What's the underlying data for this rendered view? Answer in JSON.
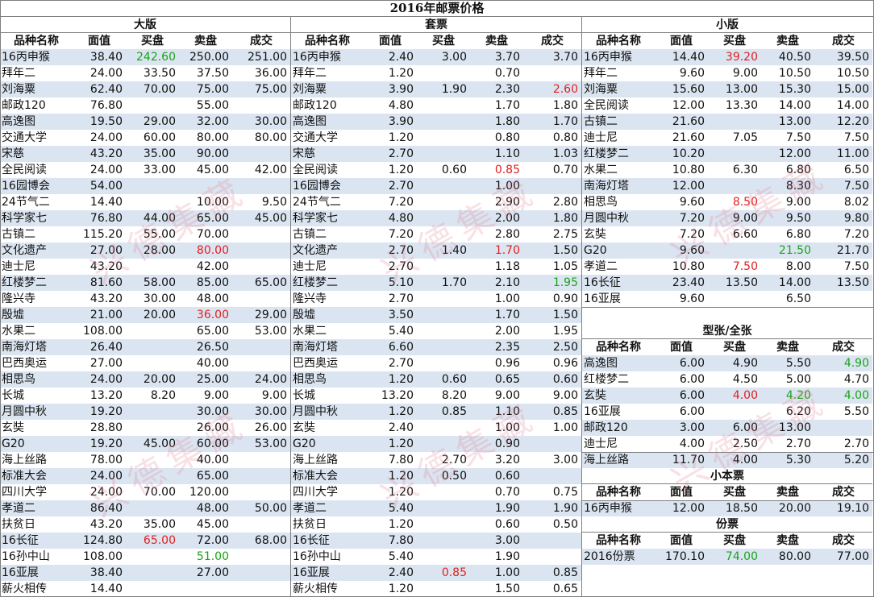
{
  "title": "2016年邮票价格",
  "headers": [
    "品种名称",
    "面值",
    "买盘",
    "卖盘",
    "成交"
  ],
  "colors": {
    "band": "#dbe5f1",
    "red": "#e02020",
    "green": "#1aa31a",
    "grid": "#7f7f7f"
  },
  "watermark": "兴德集藏",
  "panels": [
    {
      "key": "daban",
      "title": "大版",
      "rows": [
        [
          "16丙申猴",
          "38.40",
          "242.60",
          "250.00",
          "251.00"
        ],
        [
          "拜年二",
          "24.00",
          "33.50",
          "37.50",
          "36.00"
        ],
        [
          "刘海粟",
          "62.40",
          "70.00",
          "75.00",
          "75.00"
        ],
        [
          "邮政120",
          "76.80",
          "",
          "55.00",
          ""
        ],
        [
          "高逸图",
          "19.50",
          "29.00",
          "32.00",
          "30.00"
        ],
        [
          "交通大学",
          "24.00",
          "60.00",
          "80.00",
          "80.00"
        ],
        [
          "宋慈",
          "43.20",
          "35.00",
          "90.00",
          ""
        ],
        [
          "全民阅读",
          "24.00",
          "33.00",
          "45.00",
          "42.00"
        ],
        [
          "16园博会",
          "54.00",
          "",
          "",
          ""
        ],
        [
          "24节气二",
          "14.40",
          "",
          "10.00",
          "9.50"
        ],
        [
          "科学家七",
          "76.80",
          "44.00",
          "65.00",
          "45.00"
        ],
        [
          "古镇二",
          "115.20",
          "55.00",
          "70.00",
          ""
        ],
        [
          "文化遗产",
          "27.00",
          "28.00",
          "80.00",
          ""
        ],
        [
          "迪士尼",
          "43.20",
          "",
          "42.00",
          ""
        ],
        [
          "红楼梦二",
          "81.60",
          "58.00",
          "85.00",
          "65.00"
        ],
        [
          "隆兴寺",
          "43.20",
          "30.00",
          "48.00",
          ""
        ],
        [
          "殷墟",
          "21.00",
          "20.00",
          "36.00",
          "29.00"
        ],
        [
          "水果二",
          "108.00",
          "",
          "65.00",
          "53.00"
        ],
        [
          "南海灯塔",
          "26.40",
          "",
          "26.50",
          ""
        ],
        [
          "巴西奥运",
          "27.00",
          "",
          "40.00",
          ""
        ],
        [
          "相思鸟",
          "24.00",
          "20.00",
          "25.00",
          "24.00"
        ],
        [
          "长城",
          "13.20",
          "8.20",
          "9.00",
          "9.00"
        ],
        [
          "月圆中秋",
          "19.20",
          "",
          "30.00",
          "30.00"
        ],
        [
          "玄奘",
          "28.80",
          "",
          "26.00",
          "26.00"
        ],
        [
          "G20",
          "19.20",
          "45.00",
          "60.00",
          "53.00"
        ],
        [
          "海上丝路",
          "78.00",
          "",
          "40.00",
          ""
        ],
        [
          "标准大会",
          "24.00",
          "",
          "65.00",
          ""
        ],
        [
          "四川大学",
          "24.00",
          "70.00",
          "120.00",
          ""
        ],
        [
          "孝道二",
          "86.40",
          "",
          "48.00",
          "50.00"
        ],
        [
          "扶贫日",
          "43.20",
          "35.00",
          "45.00",
          ""
        ],
        [
          "16长征",
          "124.80",
          "65.00",
          "72.00",
          "68.00"
        ],
        [
          "16孙中山",
          "108.00",
          "",
          "51.00",
          ""
        ],
        [
          "16亚展",
          "38.40",
          "",
          "27.00",
          ""
        ],
        [
          "薪火相传",
          "14.40",
          "",
          "",
          ""
        ]
      ]
    },
    {
      "key": "taopiao",
      "title": "套票",
      "rows": [
        [
          "16丙申猴",
          "2.40",
          "3.00",
          "3.70",
          "3.70"
        ],
        [
          "拜年二",
          "1.20",
          "",
          "0.70",
          ""
        ],
        [
          "刘海粟",
          "3.90",
          "1.90",
          "2.30",
          "2.60"
        ],
        [
          "邮政120",
          "4.80",
          "",
          "1.70",
          "1.80"
        ],
        [
          "高逸图",
          "3.90",
          "",
          "1.80",
          "1.70"
        ],
        [
          "交通大学",
          "1.20",
          "",
          "0.80",
          "0.80"
        ],
        [
          "宋慈",
          "2.70",
          "",
          "1.10",
          "1.03"
        ],
        [
          "全民阅读",
          "1.20",
          "0.60",
          "0.85",
          "0.70"
        ],
        [
          "16园博会",
          "2.70",
          "",
          "1.00",
          ""
        ],
        [
          "24节气二",
          "7.20",
          "",
          "2.90",
          "2.80"
        ],
        [
          "科学家七",
          "4.80",
          "",
          "2.00",
          "1.80"
        ],
        [
          "古镇二",
          "7.20",
          "",
          "2.80",
          "2.75"
        ],
        [
          "文化遗产",
          "2.70",
          "1.40",
          "1.70",
          "1.50"
        ],
        [
          "迪士尼",
          "2.70",
          "",
          "1.18",
          "1.05"
        ],
        [
          "红楼梦二",
          "5.10",
          "1.70",
          "2.10",
          "1.95"
        ],
        [
          "隆兴寺",
          "2.70",
          "",
          "1.00",
          "0.90"
        ],
        [
          "殷墟",
          "3.50",
          "",
          "1.70",
          "1.50"
        ],
        [
          "水果二",
          "5.40",
          "",
          "2.00",
          "1.95"
        ],
        [
          "南海灯塔",
          "6.60",
          "",
          "2.35",
          "2.50"
        ],
        [
          "巴西奥运",
          "2.70",
          "",
          "0.96",
          "0.96"
        ],
        [
          "相思鸟",
          "1.20",
          "0.60",
          "0.65",
          "0.60"
        ],
        [
          "长城",
          "13.20",
          "8.20",
          "9.00",
          "9.00"
        ],
        [
          "月圆中秋",
          "1.20",
          "0.85",
          "1.10",
          "0.85"
        ],
        [
          "玄奘",
          "2.40",
          "",
          "1.00",
          "1.00"
        ],
        [
          "G20",
          "1.20",
          "",
          "0.90",
          ""
        ],
        [
          "海上丝路",
          "7.80",
          "2.70",
          "3.20",
          "3.00"
        ],
        [
          "标准大会",
          "1.20",
          "0.50",
          "0.60",
          ""
        ],
        [
          "四川大学",
          "1.20",
          "",
          "0.70",
          "0.75"
        ],
        [
          "孝道二",
          "5.40",
          "",
          "1.90",
          "1.90"
        ],
        [
          "扶贫日",
          "1.20",
          "",
          "0.60",
          "0.50"
        ],
        [
          "16长征",
          "7.80",
          "",
          "3.00",
          ""
        ],
        [
          "16孙中山",
          "5.40",
          "",
          "1.90",
          ""
        ],
        [
          "16亚展",
          "2.40",
          "0.85",
          "1.00",
          "0.85"
        ],
        [
          "薪火相传",
          "1.20",
          "",
          "1.50",
          "0.65"
        ]
      ]
    },
    {
      "key": "xiaoban",
      "title": "小版",
      "rows": [
        [
          "16丙申猴",
          "14.40",
          "39.20",
          "40.50",
          "39.50"
        ],
        [
          "拜年二",
          "9.60",
          "9.00",
          "10.50",
          "10.50"
        ],
        [
          "刘海粟",
          "15.60",
          "13.00",
          "15.30",
          "15.00"
        ],
        [
          "全民阅读",
          "12.00",
          "13.30",
          "14.00",
          "14.00"
        ],
        [
          "古镇二",
          "21.60",
          "",
          "13.00",
          "12.20"
        ],
        [
          "迪士尼",
          "21.60",
          "7.05",
          "7.50",
          "7.50"
        ],
        [
          "红楼梦二",
          "10.20",
          "",
          "12.00",
          "11.00"
        ],
        [
          "水果二",
          "10.80",
          "6.30",
          "6.80",
          "6.50"
        ],
        [
          "南海灯塔",
          "12.00",
          "",
          "8.30",
          "7.50"
        ],
        [
          "相思鸟",
          "9.60",
          "8.50",
          "9.00",
          "8.02"
        ],
        [
          "月圆中秋",
          "7.20",
          "9.00",
          "9.50",
          "9.80"
        ],
        [
          "玄奘",
          "7.20",
          "6.60",
          "6.80",
          "7.20"
        ],
        [
          "G20",
          "9.60",
          "",
          "21.50",
          "21.70"
        ],
        [
          "孝道二",
          "10.80",
          "7.50",
          "8.00",
          "7.50"
        ],
        [
          "16长征",
          "23.40",
          "13.50",
          "14.00",
          "13.50"
        ],
        [
          "16亚展",
          "9.60",
          "",
          "6.50",
          ""
        ]
      ]
    },
    {
      "key": "xingzhang",
      "title": "型张/全张",
      "rows": [
        [
          "高逸图",
          "6.00",
          "4.90",
          "5.50",
          "4.90"
        ],
        [
          "红楼梦二",
          "6.00",
          "4.50",
          "5.00",
          "4.70"
        ],
        [
          "玄奘",
          "6.00",
          "4.00",
          "4.20",
          "4.00"
        ],
        [
          "16亚展",
          "6.00",
          "",
          "6.20",
          "5.50"
        ],
        [
          "邮政120",
          "3.00",
          "6.00",
          "13.00",
          ""
        ],
        [
          "迪士尼",
          "4.00",
          "2.50",
          "2.70",
          "2.70"
        ],
        [
          "海上丝路",
          "11.70",
          "4.00",
          "5.30",
          "5.20"
        ]
      ]
    },
    {
      "key": "xiaobenpiao",
      "title": "小本票",
      "rows": [
        [
          "16丙申猴",
          "12.00",
          "18.50",
          "20.00",
          "19.10"
        ]
      ]
    },
    {
      "key": "fenpiao",
      "title": "份票",
      "rows": [
        [
          "2016份票",
          "170.10",
          "74.00",
          "80.00",
          "77.00"
        ]
      ]
    }
  ]
}
